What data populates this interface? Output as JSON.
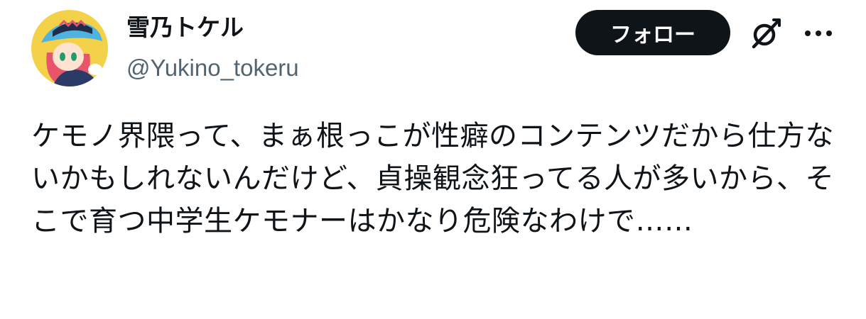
{
  "author": {
    "display_name": "雪乃トケル",
    "handle": "@Yukino_tokeru",
    "avatar_icon": "user-avatar-icon"
  },
  "actions": {
    "follow_label": "フォロー",
    "grok_icon": "grok-slash-icon",
    "more_icon": "more-dots-icon"
  },
  "tweet": {
    "text": "ケモノ界隈って、まぁ根っこが性癖のコンテンツだから仕方ないかもしれないんだけど、貞操観念狂ってる人が多いから、そこで育つ中学生ケモナーはかなり危険なわけで……"
  },
  "colors": {
    "text_primary": "#0f1419",
    "text_secondary": "#536471",
    "follow_bg": "#0f1419",
    "follow_text": "#ffffff"
  }
}
